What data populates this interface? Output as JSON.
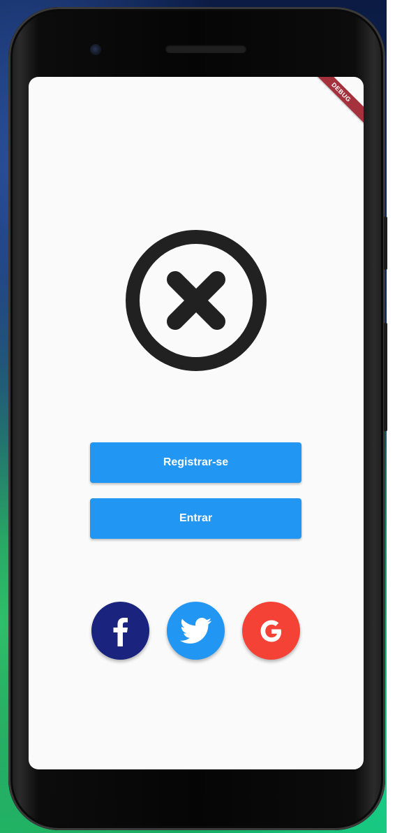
{
  "debug_banner": {
    "label": "DEBUG"
  },
  "logo": {
    "icon": "cancel-icon",
    "color": "#212121"
  },
  "actions": {
    "register_label": "Registrar-se",
    "login_label": "Entrar",
    "button_color": "#2196f3"
  },
  "social": [
    {
      "name": "facebook",
      "icon": "facebook-icon",
      "color": "#1a237e"
    },
    {
      "name": "twitter",
      "icon": "twitter-icon",
      "color": "#2196f3"
    },
    {
      "name": "google",
      "icon": "google-icon",
      "color": "#f44336"
    }
  ]
}
